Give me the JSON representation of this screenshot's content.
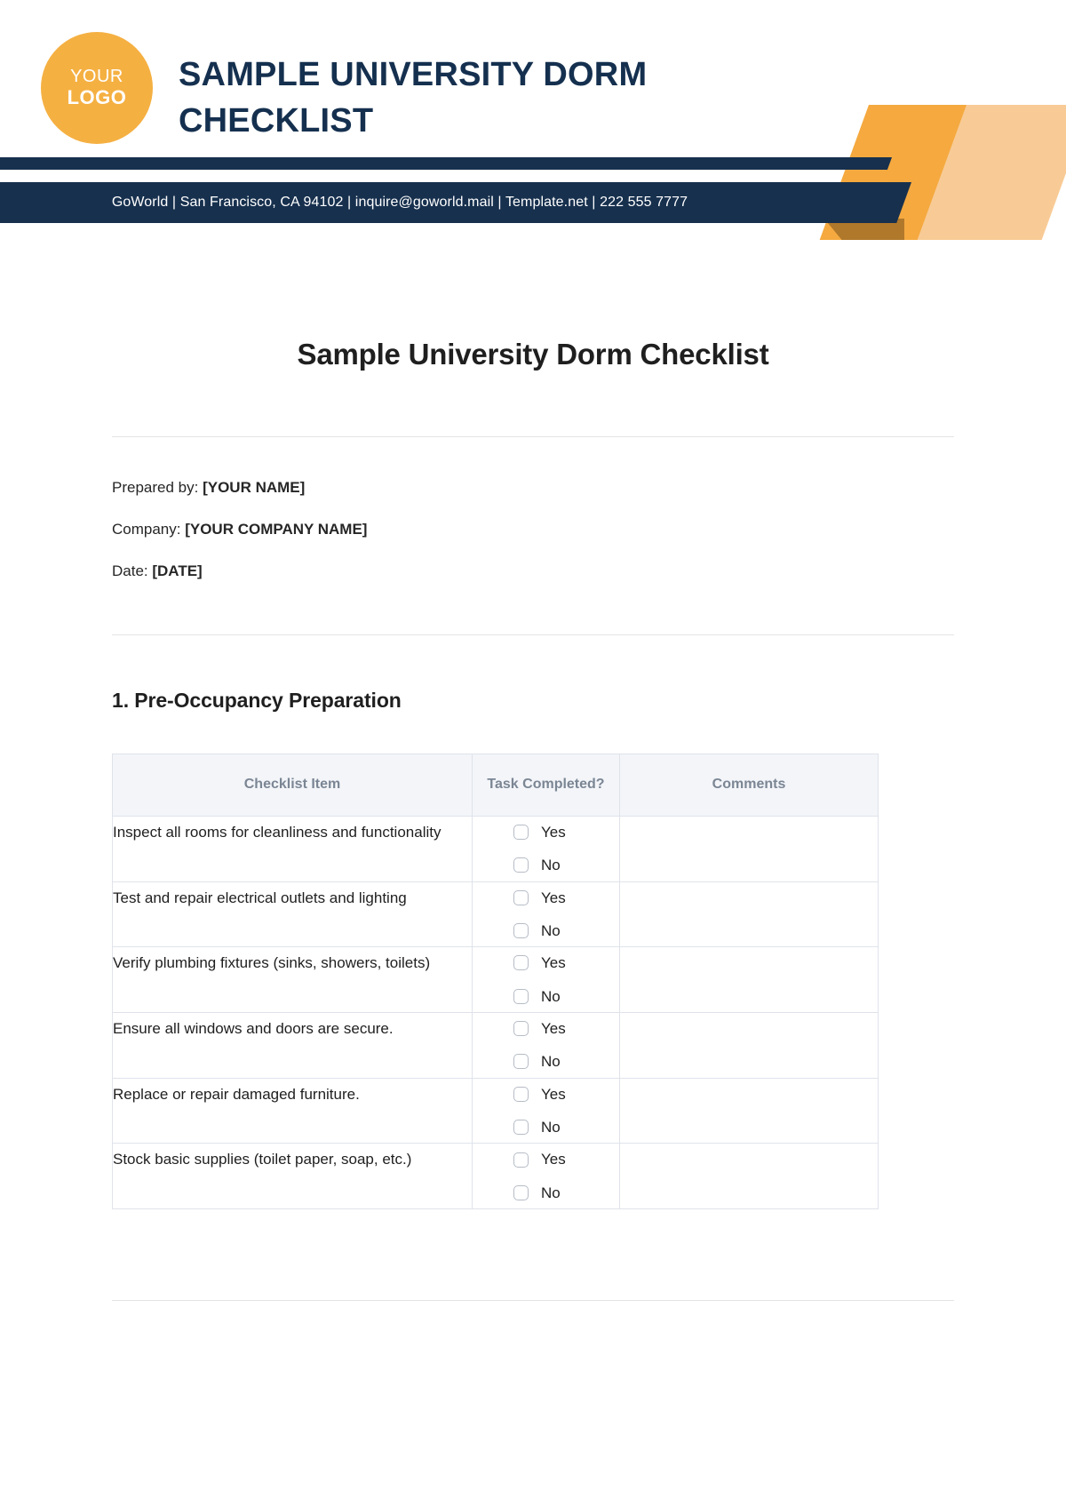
{
  "header": {
    "logo": {
      "line1": "YOUR",
      "line2": "LOGO"
    },
    "title": "SAMPLE UNIVERSITY DORM CHECKLIST",
    "contact": "GoWorld | San Francisco, CA 94102  |  inquire@goworld.mail |  Template.net | 222 555 7777"
  },
  "document": {
    "title": "Sample University Dorm Checklist",
    "meta": [
      {
        "label": "Prepared by: ",
        "value": "[YOUR NAME]"
      },
      {
        "label": "Company: ",
        "value": "[YOUR COMPANY NAME]"
      },
      {
        "label": "Date: ",
        "value": "[DATE]"
      }
    ]
  },
  "section": {
    "title": "1. Pre-Occupancy Preparation",
    "table": {
      "columns": [
        "Checklist Item",
        "Task Completed?",
        "Comments"
      ],
      "options": {
        "yes": "Yes",
        "no": "No"
      },
      "rows": [
        {
          "item": "Inspect all rooms for cleanliness and functionality",
          "yes_checked": false,
          "no_checked": false,
          "comment": ""
        },
        {
          "item": "Test and repair electrical outlets and lighting",
          "yes_checked": false,
          "no_checked": false,
          "comment": ""
        },
        {
          "item": "Verify plumbing fixtures (sinks, showers, toilets)",
          "yes_checked": false,
          "no_checked": false,
          "comment": ""
        },
        {
          "item": "Ensure all windows and doors are secure.",
          "yes_checked": false,
          "no_checked": false,
          "comment": ""
        },
        {
          "item": "Replace or repair damaged furniture.",
          "yes_checked": false,
          "no_checked": false,
          "comment": ""
        },
        {
          "item": "Stock basic supplies (toilet paper, soap, etc.)",
          "yes_checked": false,
          "no_checked": false,
          "comment": ""
        }
      ]
    }
  },
  "colors": {
    "navy": "#17304e",
    "orange": "#f5b042",
    "orange_deco": "#f5a93f",
    "peach": "#f8cb96",
    "bronze": "#b0782a",
    "header_bg": "#f3f5f9",
    "header_text": "#7b8694",
    "border": "#dfe3ea"
  }
}
